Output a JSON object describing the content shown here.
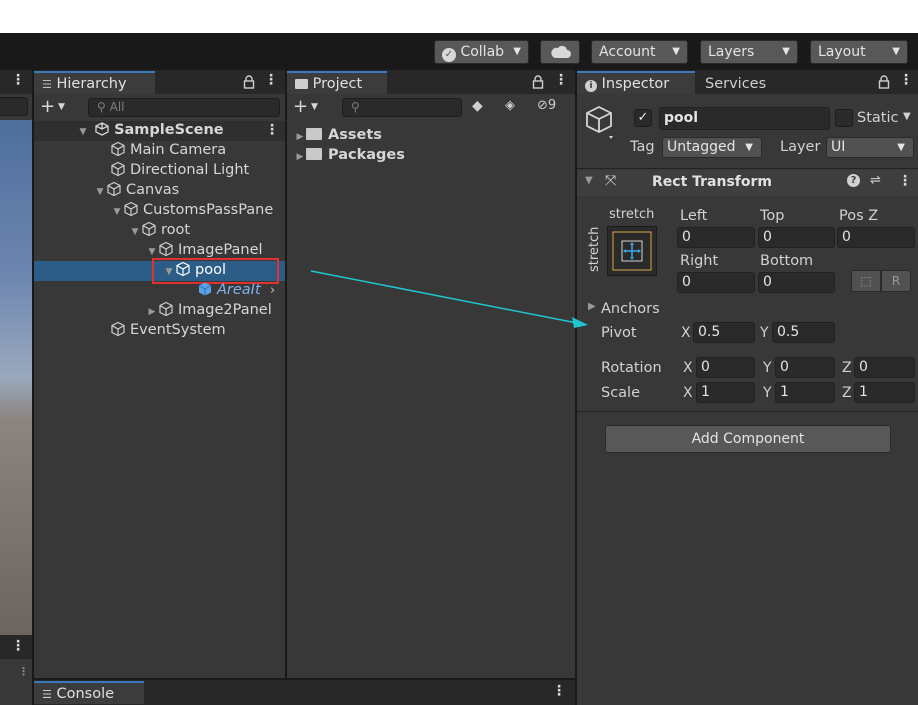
{
  "toolbar": {
    "collab": "Collab",
    "account": "Account",
    "layers": "Layers",
    "layout": "Layout"
  },
  "hierarchy": {
    "tab": "Hierarchy",
    "search_placeholder": "All",
    "items": [
      {
        "label": "SampleScene"
      },
      {
        "label": "Main Camera"
      },
      {
        "label": "Directional Light"
      },
      {
        "label": "Canvas"
      },
      {
        "label": "CustomsPassPane"
      },
      {
        "label": "root"
      },
      {
        "label": "ImagePanel"
      },
      {
        "label": "pool"
      },
      {
        "label": "AreaIt"
      },
      {
        "label": "Image2Panel"
      },
      {
        "label": "EventSystem"
      }
    ]
  },
  "project": {
    "tab": "Project",
    "hidden_count": "9",
    "folders": [
      {
        "label": "Assets"
      },
      {
        "label": "Packages"
      }
    ]
  },
  "console": {
    "tab": "Console"
  },
  "inspector": {
    "tab": "Inspector",
    "services_tab": "Services",
    "object_name": "pool",
    "static_label": "Static",
    "tag_label": "Tag",
    "tag_value": "Untagged",
    "layer_label": "Layer",
    "layer_value": "UI",
    "component_title": "Rect Transform",
    "anchor_h": "stretch",
    "anchor_v": "stretch",
    "left_label": "Left",
    "left_value": "0",
    "top_label": "Top",
    "top_value": "0",
    "posz_label": "Pos Z",
    "posz_value": "0",
    "right_label": "Right",
    "right_value": "0",
    "bottom_label": "Bottom",
    "bottom_value": "0",
    "anchors_label": "Anchors",
    "pivot_label": "Pivot",
    "pivot_x": "0.5",
    "pivot_y": "0.5",
    "rotation_label": "Rotation",
    "rot_x": "0",
    "rot_y": "0",
    "rot_z": "0",
    "scale_label": "Scale",
    "scale_x": "1",
    "scale_y": "1",
    "scale_z": "1",
    "axis_x": "X",
    "axis_y": "Y",
    "axis_z": "Z",
    "raw_button": "R",
    "add_component": "Add Component"
  },
  "colors": {
    "selection": "#2c5d87",
    "highlight_box": "#e03131",
    "arrow": "#1fc6d0",
    "panel": "#383838",
    "toolbar": "#191919"
  }
}
